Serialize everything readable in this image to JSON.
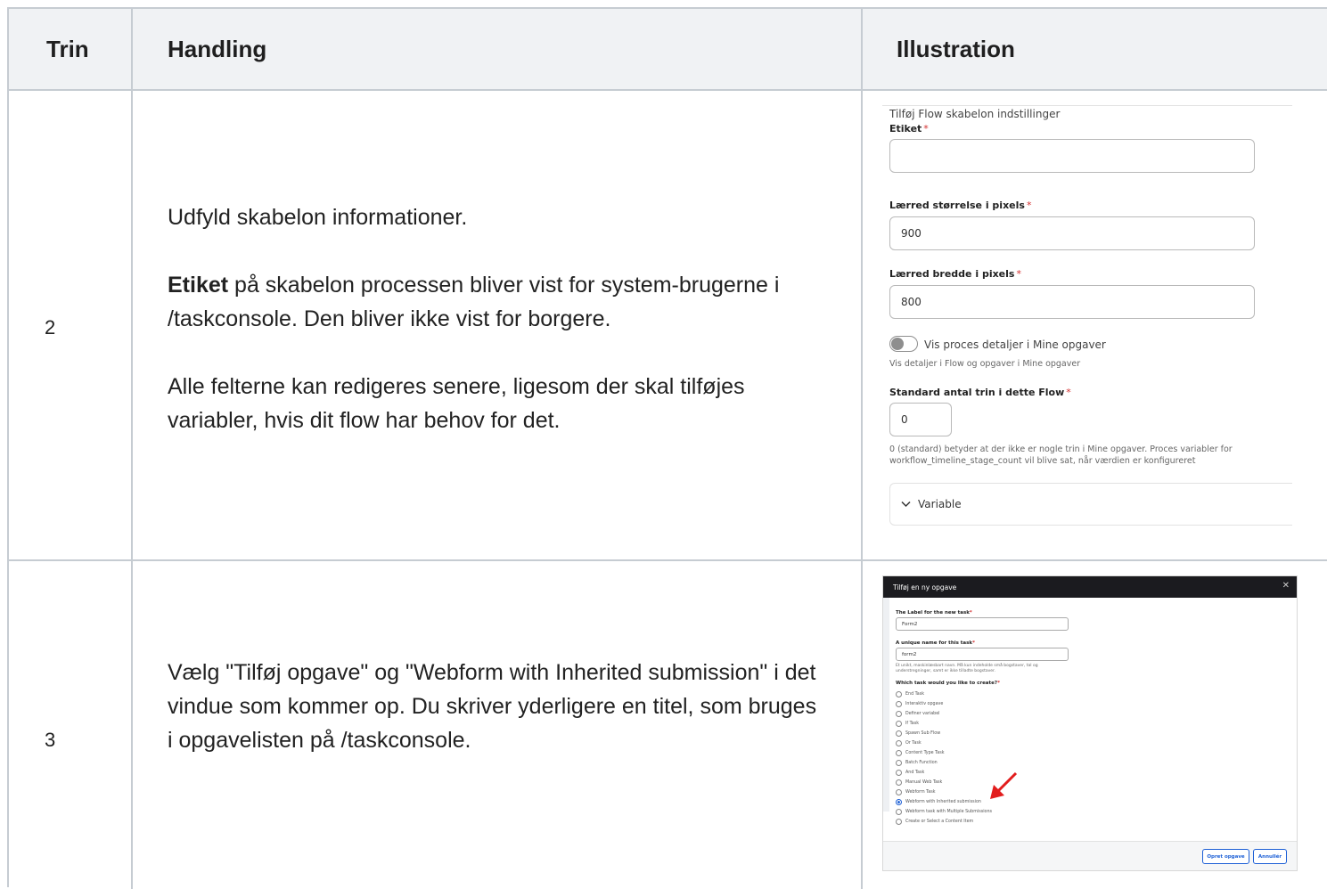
{
  "table": {
    "headers": {
      "step": "Trin",
      "action": "Handling",
      "illustration": "Illustration"
    },
    "rows": [
      {
        "step": "2",
        "paragraphs": [
          {
            "bold": "",
            "text": "Udfyld skabelon informationer."
          },
          {
            "bold": "Etiket",
            "text": " på skabelon processen bliver vist for system-brugerne i /taskconsole. Den bliver ikke vist for borgere."
          },
          {
            "bold": "",
            "text": "Alle felterne kan redigeres senere, ligesom der skal tilføjes variabler, hvis dit flow har behov for det."
          }
        ]
      },
      {
        "step": "3",
        "paragraphs": [
          {
            "bold": "",
            "text": "Vælg \"Tilføj opgave\" og \"Webform with Inherited submission\" i det vindue som kommer op. Du skriver yderligere en titel, som bruges i opgavelisten på /taskconsole."
          }
        ]
      }
    ]
  },
  "illustration_settings": {
    "section_title": "Tilføj Flow skabelon indstillinger",
    "required_marker": "*",
    "label_field": {
      "label": "Etiket",
      "value": ""
    },
    "canvas_size_field": {
      "label": "Lærred størrelse i pixels",
      "value": "900"
    },
    "canvas_width_field": {
      "label": "Lærred bredde i pixels",
      "value": "800"
    },
    "toggle": {
      "label": "Vis proces detaljer i Mine opgaver",
      "help": "Vis detaljer i Flow og opgaver i Mine opgaver",
      "on": false
    },
    "stage_count_field": {
      "label": "Standard antal trin i dette Flow",
      "value": "0",
      "help": "0 (standard) betyder at der ikke er nogle trin i Mine opgaver. Proces variabler for workflow_timeline_stage_count vil blive sat, når værdien er konfigureret"
    },
    "variable_section": {
      "label": "Variable",
      "icon": "chevron-down-icon"
    }
  },
  "illustration_dialog": {
    "title": "Tilføj en ny opgave",
    "close_icon": "close-icon",
    "label_field": {
      "label": "The Label for the new task",
      "value": "Form2"
    },
    "machine_name_field": {
      "label": "A unique name for this task",
      "value": "form2",
      "help": "Et unikt, maskinlæsbart navn. Må kun indeholde små bogstaver, tal og understregninger, samt er ikke tilladte bogstaver."
    },
    "task_type_label": "Which task would you like to create?",
    "task_types": [
      {
        "label": "End Task",
        "selected": false
      },
      {
        "label": "Interaktiv opgave",
        "selected": false
      },
      {
        "label": "Definer variabel",
        "selected": false
      },
      {
        "label": "If Task",
        "selected": false
      },
      {
        "label": "Spawn Sub Flow",
        "selected": false
      },
      {
        "label": "Or Task",
        "selected": false
      },
      {
        "label": "Content Type Task",
        "selected": false
      },
      {
        "label": "Batch Function",
        "selected": false
      },
      {
        "label": "And Task",
        "selected": false
      },
      {
        "label": "Manual Web Task",
        "selected": false
      },
      {
        "label": "Webform Task",
        "selected": false
      },
      {
        "label": "Webform with Inherited submission",
        "selected": true
      },
      {
        "label": "Webform task with Multiple Submissions",
        "selected": false
      },
      {
        "label": "Create or Select a Content Item",
        "selected": false
      }
    ],
    "buttons": {
      "create": "Opret opgave",
      "cancel": "Annullér"
    },
    "colors": {
      "header_bg": "#1b1b1f",
      "accent": "#1c5fd6",
      "arrow": "#e21c1c"
    }
  }
}
